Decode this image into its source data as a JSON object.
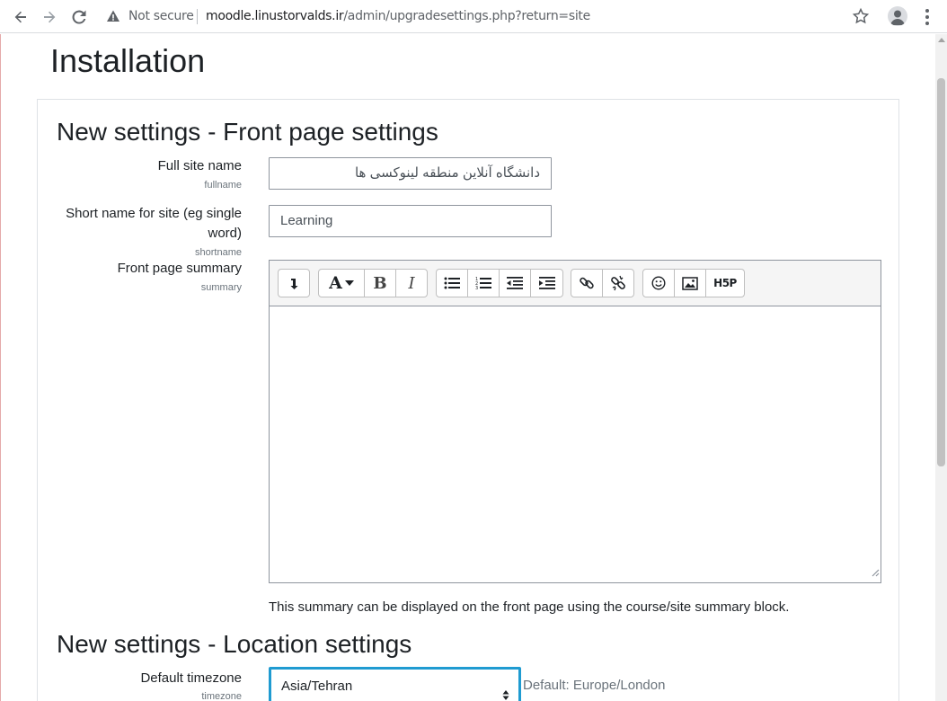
{
  "browser": {
    "security_label": "Not secure",
    "url_host": "moodle.linustorvalds.ir",
    "url_path": "/admin/upgradesettings.php?return=site"
  },
  "page": {
    "title": "Installation"
  },
  "sections": {
    "front_page": {
      "heading": "New settings - Front page settings",
      "fullname": {
        "label": "Full site name",
        "sub": "fullname",
        "value": "دانشگاه آنلاین منطقه لینوکسی ها"
      },
      "shortname": {
        "label_line1": "Short name for site (eg single",
        "label_line2": "word)",
        "sub": "shortname",
        "value": "Learning"
      },
      "summary": {
        "label": "Front page summary",
        "sub": "summary",
        "help": "This summary can be displayed on the front page using the course/site summary block."
      }
    },
    "location": {
      "heading": "New settings - Location settings",
      "timezone": {
        "label": "Default timezone",
        "sub": "timezone",
        "selected": "Asia/Tehran",
        "default_note": "Default: Europe/London"
      }
    }
  },
  "editor_toolbar": {
    "icons": [
      "collapse-icon",
      "font-color-icon",
      "bold-icon",
      "italic-icon",
      "unordered-list-icon",
      "ordered-list-icon",
      "outdent-icon",
      "indent-icon",
      "link-icon",
      "unlink-icon",
      "emoji-icon",
      "image-icon",
      "h5p-icon"
    ],
    "bold_glyph": "B",
    "italic_glyph": "I",
    "font_glyph": "A",
    "h5p_glyph": "H5P"
  },
  "colors": {
    "focus_border": "#1f9bd1",
    "text": "#1d2125",
    "muted": "#6a737b"
  }
}
